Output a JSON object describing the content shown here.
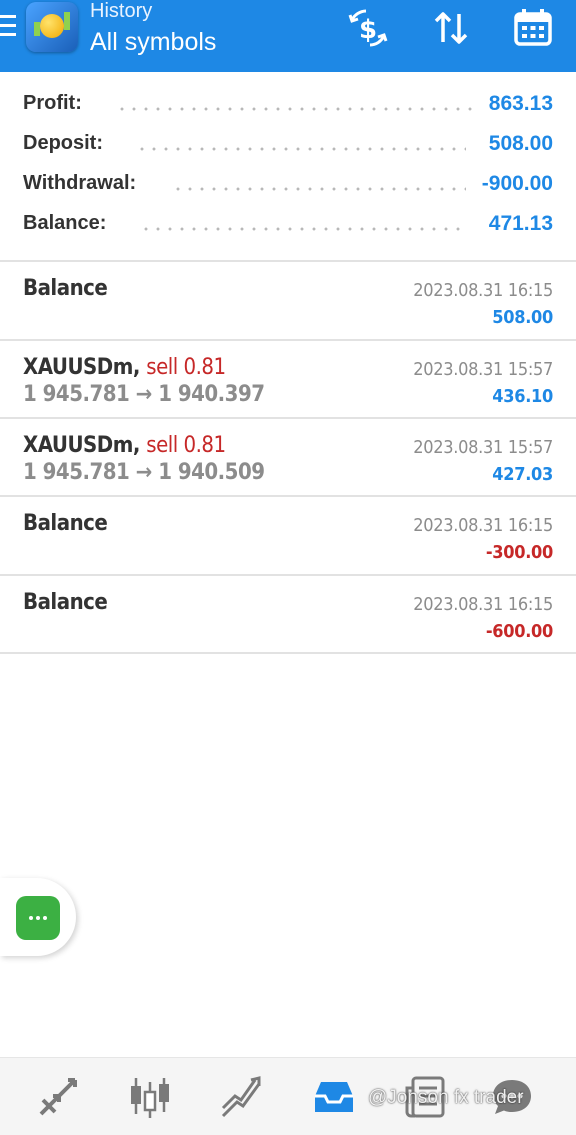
{
  "header": {
    "subtitle": "History",
    "title": "All symbols",
    "icons": [
      "menu-icon",
      "currency-exchange-icon",
      "sort-icon",
      "calendar-icon"
    ]
  },
  "summary": [
    {
      "label": "Profit:",
      "value": "863.13"
    },
    {
      "label": "Deposit:",
      "value": "508.00"
    },
    {
      "label": "Withdrawal:",
      "value": "-900.00"
    },
    {
      "label": "Balance:",
      "value": "471.13"
    }
  ],
  "deals": [
    {
      "title": "Balance",
      "time": "2023.08.31 16:15",
      "amount": "508.00"
    },
    {
      "symbol": "XAUUSDm,",
      "action": "sell 0.81",
      "open": "1 945.781",
      "arrow": "→",
      "close": "1 940.397",
      "time": "2023.08.31 15:57",
      "amount": "436.10"
    },
    {
      "symbol": "XAUUSDm,",
      "action": "sell 0.81",
      "open": "1 945.781",
      "arrow": "→",
      "close": "1 940.509",
      "time": "2023.08.31 15:57",
      "amount": "427.03"
    },
    {
      "title": "Balance",
      "time": "2023.08.31 16:15",
      "amount": "-300.00"
    },
    {
      "title": "Balance",
      "time": "2023.08.31 16:15",
      "amount": "-600.00"
    }
  ],
  "bottom_nav": {
    "items": [
      "quotes-icon",
      "chart-icon",
      "trade-icon",
      "history-icon",
      "news-icon",
      "messages-icon"
    ],
    "active": "history-icon",
    "watermark": "@Jonson fx trader"
  },
  "colors": {
    "accent": "#1e88e5",
    "negative": "#c62828",
    "fab": "#3cb043"
  }
}
